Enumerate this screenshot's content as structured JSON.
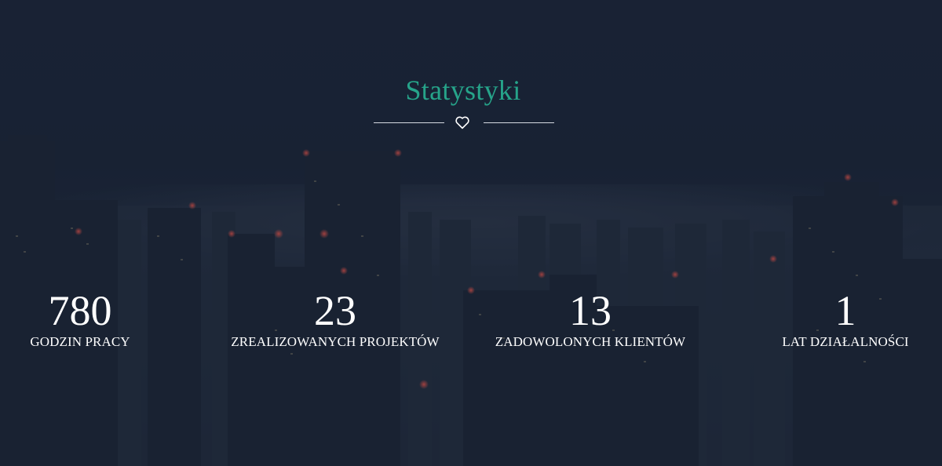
{
  "section": {
    "title": "Statystyki",
    "divider_icon": "heart-outline-icon"
  },
  "stats": [
    {
      "value": "780",
      "label": "GODZIN PRACY"
    },
    {
      "value": "23",
      "label": "ZREALIZOWANYCH PROJEKTÓW"
    },
    {
      "value": "13",
      "label": "ZADOWOLONYCH KLIENTÓW"
    },
    {
      "value": "1",
      "label": "LAT DZIAŁALNOŚCI"
    }
  ],
  "colors": {
    "accent": "#26a48a",
    "text": "#ffffff",
    "background": "#1c2637"
  }
}
